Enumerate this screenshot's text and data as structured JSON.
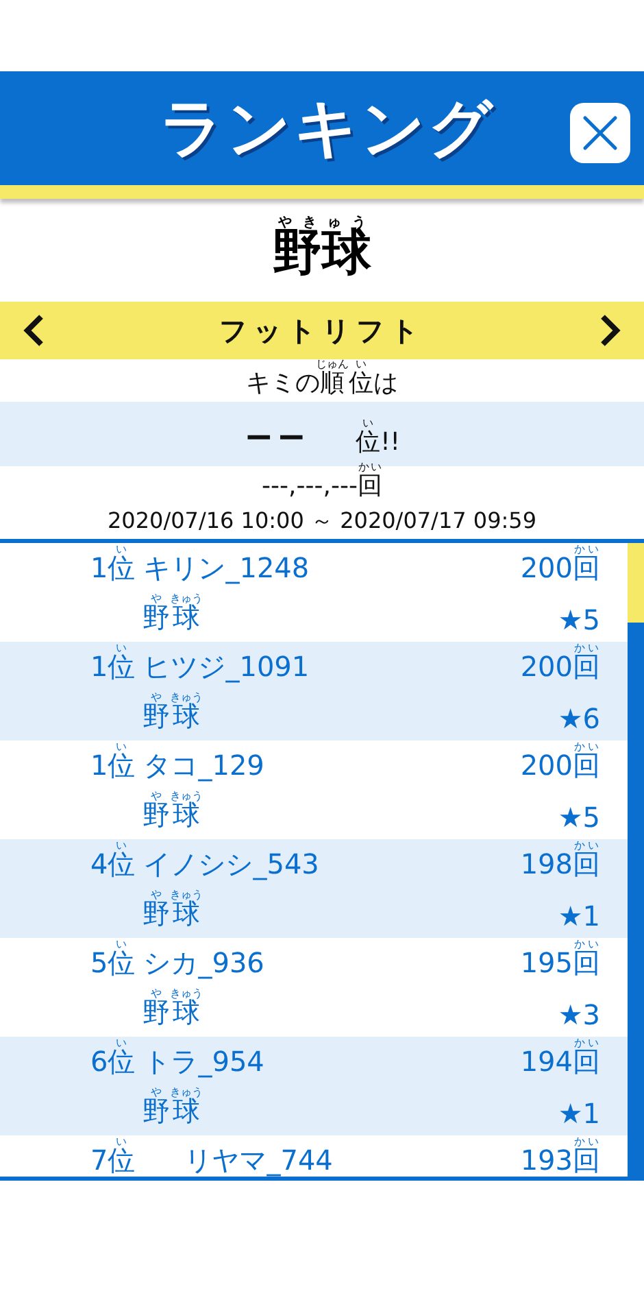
{
  "header": {
    "title": "ランキング"
  },
  "sport_title": [
    {
      "text": "野球",
      "ruby": "やきゅう"
    }
  ],
  "event_selector": {
    "label": "フットリフト"
  },
  "my_rank": {
    "caption": [
      {
        "text": "キミの"
      },
      {
        "text": "順",
        "ruby": "じゅん"
      },
      {
        "text": "位",
        "ruby": "い"
      },
      {
        "text": "は"
      }
    ],
    "rank": "−−",
    "suffix": [
      {
        "text": "位",
        "ruby": "い"
      },
      {
        "text": "!!"
      }
    ],
    "count": [
      {
        "text": "---,---,---"
      },
      {
        "text": "回",
        "ruby": "かい"
      }
    ]
  },
  "period": "2020/07/16 10:00 ～ 2020/07/17 09:59",
  "rows": [
    {
      "rank": [
        {
          "text": "1"
        },
        {
          "text": "位",
          "ruby": "い"
        }
      ],
      "name": "キリン_1248",
      "count": [
        {
          "text": "200"
        },
        {
          "text": "回",
          "ruby": "かい"
        }
      ],
      "sport": [
        {
          "text": "野",
          "ruby": "や"
        },
        {
          "text": "球",
          "ruby": "きゅう"
        }
      ],
      "stars": "★5"
    },
    {
      "rank": [
        {
          "text": "1"
        },
        {
          "text": "位",
          "ruby": "い"
        }
      ],
      "name": "ヒツジ_1091",
      "count": [
        {
          "text": "200"
        },
        {
          "text": "回",
          "ruby": "かい"
        }
      ],
      "sport": [
        {
          "text": "野",
          "ruby": "や"
        },
        {
          "text": "球",
          "ruby": "きゅう"
        }
      ],
      "stars": "★6"
    },
    {
      "rank": [
        {
          "text": "1"
        },
        {
          "text": "位",
          "ruby": "い"
        }
      ],
      "name": "タコ_129",
      "count": [
        {
          "text": "200"
        },
        {
          "text": "回",
          "ruby": "かい"
        }
      ],
      "sport": [
        {
          "text": "野",
          "ruby": "や"
        },
        {
          "text": "球",
          "ruby": "きゅう"
        }
      ],
      "stars": "★5"
    },
    {
      "rank": [
        {
          "text": "4"
        },
        {
          "text": "位",
          "ruby": "い"
        }
      ],
      "name": "イノシシ_543",
      "count": [
        {
          "text": "198"
        },
        {
          "text": "回",
          "ruby": "かい"
        }
      ],
      "sport": [
        {
          "text": "野",
          "ruby": "や"
        },
        {
          "text": "球",
          "ruby": "きゅう"
        }
      ],
      "stars": "★1"
    },
    {
      "rank": [
        {
          "text": "5"
        },
        {
          "text": "位",
          "ruby": "い"
        }
      ],
      "name": "シカ_936",
      "count": [
        {
          "text": "195"
        },
        {
          "text": "回",
          "ruby": "かい"
        }
      ],
      "sport": [
        {
          "text": "野",
          "ruby": "や"
        },
        {
          "text": "球",
          "ruby": "きゅう"
        }
      ],
      "stars": "★3"
    },
    {
      "rank": [
        {
          "text": "6"
        },
        {
          "text": "位",
          "ruby": "い"
        }
      ],
      "name": "トラ_954",
      "count": [
        {
          "text": "194"
        },
        {
          "text": "回",
          "ruby": "かい"
        }
      ],
      "sport": [
        {
          "text": "野",
          "ruby": "や"
        },
        {
          "text": "球",
          "ruby": "きゅう"
        }
      ],
      "stars": "★1"
    },
    {
      "rank": [
        {
          "text": "7"
        },
        {
          "text": "位",
          "ruby": "い"
        }
      ],
      "name": "リヤマ_744",
      "count": [
        {
          "text": "193"
        },
        {
          "text": "回",
          "ruby": "かい"
        }
      ]
    }
  ]
}
